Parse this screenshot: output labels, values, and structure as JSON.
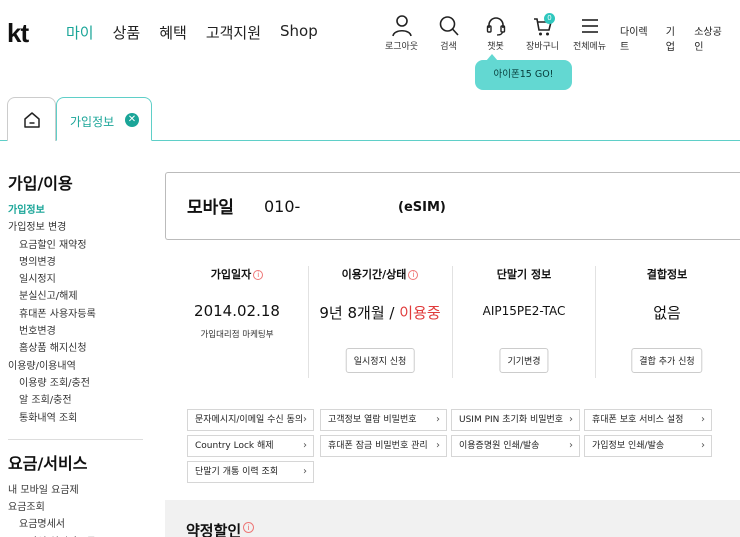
{
  "header": {
    "logo": "kt",
    "nav": [
      {
        "label": "마이",
        "active": true
      },
      {
        "label": "상품",
        "active": false
      },
      {
        "label": "혜택",
        "active": false
      },
      {
        "label": "고객지원",
        "active": false
      },
      {
        "label": "Shop",
        "active": false
      }
    ],
    "icons": [
      {
        "icon": "user-icon",
        "label": "로그아웃"
      },
      {
        "icon": "search-icon",
        "label": "검색"
      },
      {
        "icon": "headset-icon",
        "label": "챗봇"
      },
      {
        "icon": "cart-icon",
        "label": "장바구니",
        "badge": "0"
      },
      {
        "icon": "menu-icon",
        "label": "전체메뉴"
      }
    ],
    "util_links": [
      "다이렉트",
      "기업",
      "소상공인"
    ],
    "promo": "아이폰15 GO!"
  },
  "tabs": {
    "home_icon": "home-icon",
    "active_label": "가입정보",
    "close_icon": "close-icon",
    "close_glyph": "✕"
  },
  "sidebar": {
    "section1_title": "가입/이용",
    "section1_items": [
      {
        "label": "가입정보",
        "active": true,
        "sub": false
      },
      {
        "label": "가입정보 변경",
        "active": false,
        "sub": false
      },
      {
        "label": "요금할인 재약정",
        "active": false,
        "sub": true
      },
      {
        "label": "명의변경",
        "active": false,
        "sub": true
      },
      {
        "label": "일시정지",
        "active": false,
        "sub": true
      },
      {
        "label": "분실신고/해제",
        "active": false,
        "sub": true
      },
      {
        "label": "휴대폰 사용자등록",
        "active": false,
        "sub": true
      },
      {
        "label": "번호변경",
        "active": false,
        "sub": true
      },
      {
        "label": "홈상품 해지신청",
        "active": false,
        "sub": true
      },
      {
        "label": "이용량/이용내역",
        "active": false,
        "sub": false
      },
      {
        "label": "이용량 조회/충전",
        "active": false,
        "sub": true
      },
      {
        "label": "알 조회/충전",
        "active": false,
        "sub": true
      },
      {
        "label": "통화내역 조회",
        "active": false,
        "sub": true
      }
    ],
    "section2_title": "요금/서비스",
    "section2_items": [
      {
        "label": "내 모바일 요금제",
        "active": false,
        "sub": false
      },
      {
        "label": "요금조회",
        "active": false,
        "sub": false
      },
      {
        "label": "요금명세서",
        "active": false,
        "sub": true
      },
      {
        "label": "모바일 실시간요금",
        "active": false,
        "sub": true
      }
    ]
  },
  "mobile_card": {
    "title": "모바일",
    "number": "010-",
    "type": "(eSIM)"
  },
  "info": {
    "join_date": {
      "label": "가입일자",
      "value": "2014.02.18",
      "sub": "가입대리점 마케팅부"
    },
    "period": {
      "label": "이용기간/상태",
      "value_prefix": "9년 8개월 / ",
      "value_status": "이용중",
      "button": "일시정지 신청"
    },
    "device": {
      "label": "단말기 정보",
      "value": "AIP15PE2-TAC",
      "button": "기기변경"
    },
    "bundle": {
      "label": "결합정보",
      "value": "없음",
      "button": "결합 추가 신청"
    },
    "info_glyph": "i"
  },
  "quick_links": [
    "문자메시지/이메일 수신 동의",
    "고객정보 열람 비밀번호",
    "USIM PIN 초기화 비밀번호",
    "휴대폰 보호 서비스 설정",
    "Country Lock 해제",
    "휴대폰 잠금 비밀번호 관리",
    "이용증명원 인쇄/발송",
    "가입정보 인쇄/발송",
    "단말기 개통 이력 조회"
  ],
  "arrow_glyph": "›",
  "contract": {
    "title": "약정할인",
    "info_glyph": "i"
  },
  "colors": {
    "accent": "#1aa598",
    "promo": "#63d8d2",
    "status_red": "#e03b3b"
  }
}
